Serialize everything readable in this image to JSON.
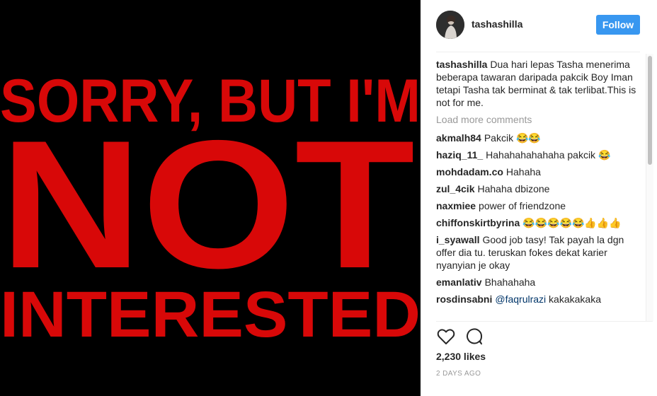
{
  "media": {
    "lines": [
      "SORRY, BUT I'M",
      "NOT",
      "INTERESTED"
    ],
    "text_color": "#d80808",
    "background": "#000000"
  },
  "header": {
    "username": "tashashilla",
    "follow_label": "Follow"
  },
  "caption": {
    "user": "tashashilla",
    "text": "Dua hari lepas Tasha menerima beberapa tawaran daripada pakcik Boy Iman tetapi Tasha tak berminat & tak terlibat.This is not for me."
  },
  "load_more": "Load more comments",
  "comments": [
    {
      "user": "akmalh84",
      "text": "Pakcik 😂😂"
    },
    {
      "user": "haziq_11_",
      "text": "Hahahahahahaha pakcik 😂"
    },
    {
      "user": "mohdadam.co",
      "text": "Hahaha"
    },
    {
      "user": "zul_4cik",
      "text": "Hahaha dbizone"
    },
    {
      "user": "naxmiee",
      "text": "power of friendzone"
    },
    {
      "user": "chiffonskirtbyrina",
      "text": "😂😂😂😂😂👍👍👍"
    },
    {
      "user": "i_syawall",
      "text": "Good job tasy! Tak payah la dgn offer dia tu. teruskan fokes dekat karier nyanyian je okay"
    },
    {
      "user": "emanlativ",
      "text": "Bhahahaha"
    },
    {
      "user": "rosdinsabni",
      "mention": "@faqrulrazi",
      "text": "kakakakaka"
    }
  ],
  "likes": "2,230 likes",
  "time_ago": "2 DAYS AGO",
  "icons": {
    "like": "heart-icon",
    "comment": "comment-bubble-icon"
  },
  "colors": {
    "accent": "#3897f0",
    "text": "#262626",
    "muted": "#999999"
  }
}
